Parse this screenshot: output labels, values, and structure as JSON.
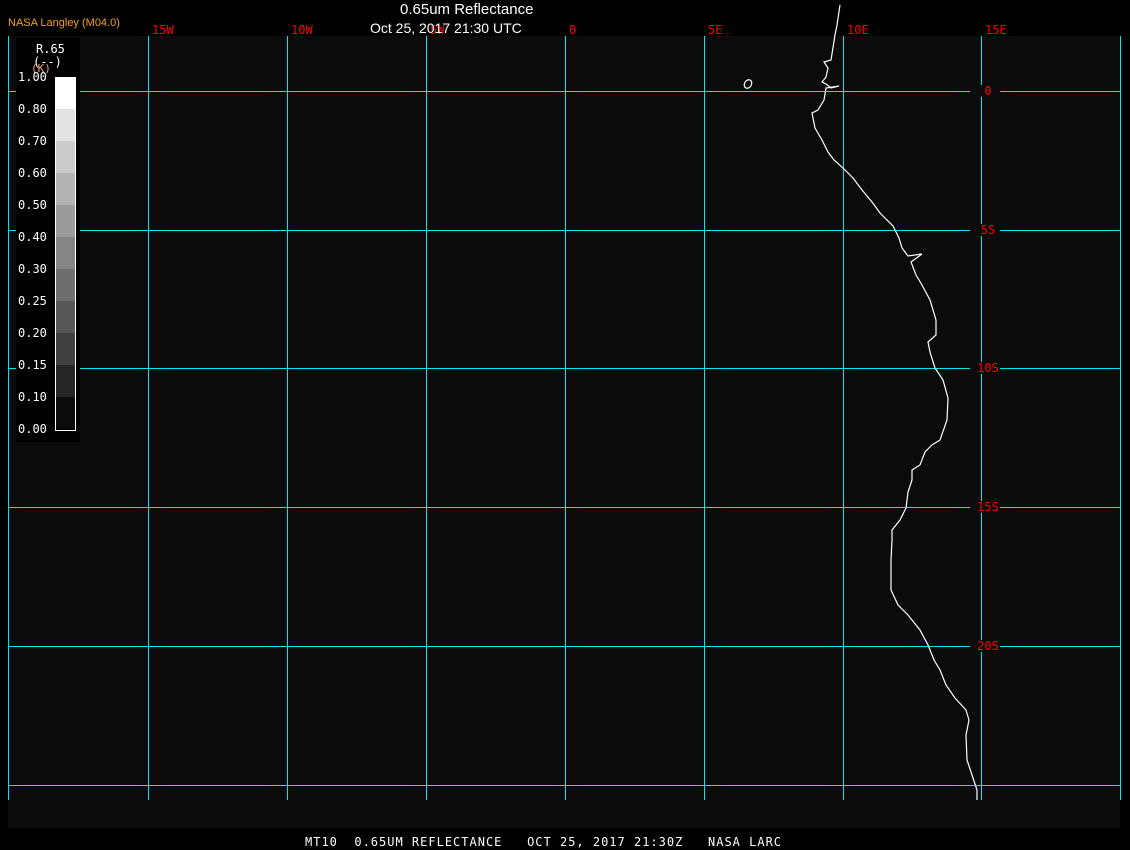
{
  "header": {
    "title": "0.65um Reflectance",
    "datetime": "Oct 25, 2017 21:30 UTC",
    "org": "NASA Langley (M04.0)"
  },
  "footer": "MT10  0.65UM REFLECTANCE   OCT 25, 2017 21:30Z   NASA LARC",
  "colorbar": {
    "name": "R.65",
    "units": "(--)",
    "extra": "(K)",
    "labels": [
      "1.00",
      "0.80",
      "0.70",
      "0.60",
      "0.50",
      "0.40",
      "0.30",
      "0.25",
      "0.20",
      "0.15",
      "0.10",
      "0.00"
    ],
    "colors": [
      "#ffffff",
      "#e3e3e3",
      "#cbcbcb",
      "#b3b3b3",
      "#9b9b9b",
      "#858585",
      "#6e6e6e",
      "#575757",
      "#404040",
      "#262626",
      "#0b0b0b"
    ]
  },
  "grid": {
    "lon_labels": [
      "15W",
      "10W",
      "5W",
      "0",
      "5E",
      "10E",
      "15E"
    ],
    "lat_labels": [
      "0",
      "5S",
      "10S",
      "15S",
      "20S"
    ],
    "grid_color": "#00e5ee",
    "label_color": "#ff0000",
    "coast_color": "#ffffff",
    "background": "#0b0b0b"
  }
}
